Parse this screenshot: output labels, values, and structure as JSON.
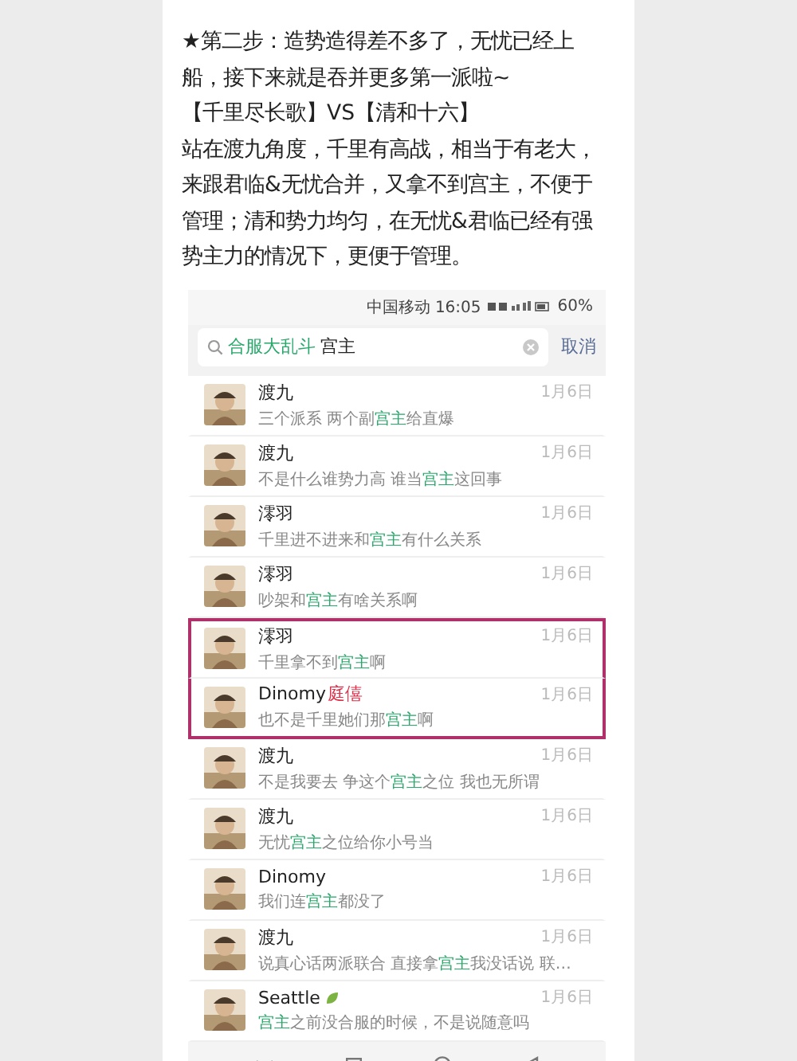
{
  "article": {
    "paragraphs": [
      "★第二步：造势造得差不多了，无忧已经上船，接下来就是吞并更多第一派啦~",
      "【千里尽长歌】VS【清和十六】",
      "站在渡九角度，千里有高战，相当于有老大，来跟君临&无忧合并，又拿不到宫主，不便于管理；清和势力均匀，在无忧&君临已经有强势主力的情况下，更便于管理。"
    ]
  },
  "phone": {
    "status_bar": {
      "carrier_time": "中国移动 16:05",
      "battery": "60%"
    },
    "search": {
      "group": "合服大乱斗",
      "query": "宫主",
      "cancel": "取消"
    },
    "messages": [
      {
        "name": "渡九",
        "date": "1月6日",
        "highlighted": false,
        "snippet": [
          {
            "t": "三个派系 两个副",
            "hit": false
          },
          {
            "t": "宫主",
            "hit": true
          },
          {
            "t": "给直爆",
            "hit": false
          }
        ]
      },
      {
        "name": "渡九",
        "date": "1月6日",
        "highlighted": false,
        "snippet": [
          {
            "t": "不是什么谁势力高 谁当",
            "hit": false
          },
          {
            "t": "宫主",
            "hit": true
          },
          {
            "t": "这回事",
            "hit": false
          }
        ]
      },
      {
        "name": "澪羽",
        "date": "1月6日",
        "highlighted": false,
        "snippet": [
          {
            "t": "千里进不进来和",
            "hit": false
          },
          {
            "t": "宫主",
            "hit": true
          },
          {
            "t": "有什么关系",
            "hit": false
          }
        ]
      },
      {
        "name": "澪羽",
        "date": "1月6日",
        "highlighted": false,
        "snippet": [
          {
            "t": "吵架和",
            "hit": false
          },
          {
            "t": "宫主",
            "hit": true
          },
          {
            "t": "有啥关系啊",
            "hit": false
          }
        ]
      },
      {
        "name": "澪羽",
        "date": "1月6日",
        "highlighted": true,
        "snippet": [
          {
            "t": "千里拿不到",
            "hit": false
          },
          {
            "t": "宫主",
            "hit": true
          },
          {
            "t": "啊",
            "hit": false
          }
        ]
      },
      {
        "name": "Dinomy",
        "tag": "庭僖",
        "date": "1月6日",
        "highlighted": true,
        "snippet": [
          {
            "t": "也不是千里她们那",
            "hit": false
          },
          {
            "t": "宫主",
            "hit": true
          },
          {
            "t": "啊",
            "hit": false
          }
        ]
      },
      {
        "name": "渡九",
        "date": "1月6日",
        "highlighted": false,
        "snippet": [
          {
            "t": "不是我要去 争这个",
            "hit": false
          },
          {
            "t": "宫主",
            "hit": true
          },
          {
            "t": "之位 我也无所谓",
            "hit": false
          }
        ]
      },
      {
        "name": "渡九",
        "date": "1月6日",
        "highlighted": false,
        "snippet": [
          {
            "t": "无忧",
            "hit": false
          },
          {
            "t": "宫主",
            "hit": true
          },
          {
            "t": "之位给你小号当",
            "hit": false
          }
        ]
      },
      {
        "name": "Dinomy",
        "date": "1月6日",
        "highlighted": false,
        "snippet": [
          {
            "t": "我们连",
            "hit": false
          },
          {
            "t": "宫主",
            "hit": true
          },
          {
            "t": "都没了",
            "hit": false
          }
        ]
      },
      {
        "name": "渡九",
        "date": "1月6日",
        "highlighted": false,
        "snippet": [
          {
            "t": "说真心话两派联合 直接拿",
            "hit": false
          },
          {
            "t": "宫主",
            "hit": true
          },
          {
            "t": "我没话说 联…",
            "hit": false
          }
        ]
      },
      {
        "name": "Seattle",
        "leaf": true,
        "date": "1月6日",
        "highlighted": false,
        "snippet": [
          {
            "t": "宫主",
            "hit": true
          },
          {
            "t": "之前没合服的时候，不是说随意吗",
            "hit": false
          }
        ]
      }
    ]
  }
}
